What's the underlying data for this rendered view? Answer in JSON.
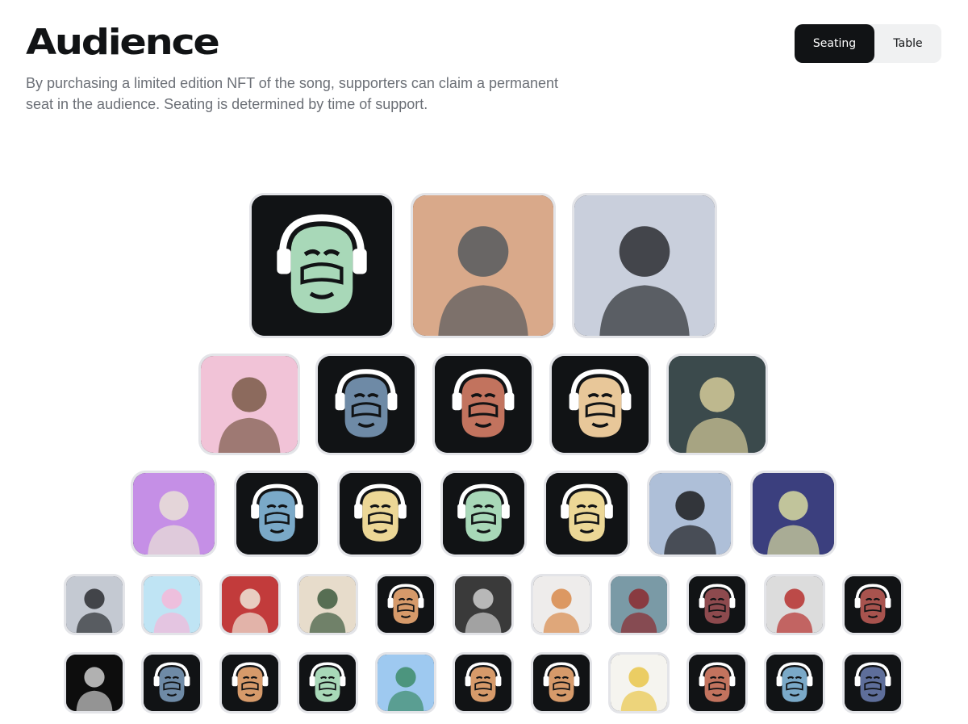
{
  "header": {
    "title": "Audience",
    "description": "By purchasing a limited edition NFT of the song, supporters can claim a permanent seat in the audience. Seating is determined by time of support."
  },
  "view_toggle": {
    "options": [
      "Seating",
      "Table"
    ],
    "selected": "Seating"
  },
  "colors": {
    "dark": "#111315",
    "seat_border": "#e3e4e8",
    "text_muted": "#6b6f76",
    "monkey_green": "#a8d8b8",
    "monkey_blue": "#6e8aa6",
    "monkey_red": "#c2735e",
    "monkey_tan": "#e8c799",
    "monkey_sky": "#7aa9c8",
    "monkey_orange": "#d69a6a",
    "monkey_maroon": "#8d4a4e",
    "monkey_yellow": "#ecd796"
  },
  "seating": {
    "rows": [
      [
        {
          "kind": "monkey",
          "icon": "monkey-headphones-icon",
          "color": "#a8d8b8",
          "label": "Supporter avatar"
        },
        {
          "kind": "photo",
          "icon": "bulldog-nft-avatar",
          "bg": "#d9a98a",
          "fg": "#555a5e"
        },
        {
          "kind": "photo",
          "icon": "person-portrait-avatar",
          "bg": "#c9cfdc",
          "fg": "#2b2d31"
        }
      ],
      [
        {
          "kind": "photo",
          "icon": "person-pink-avatar",
          "bg": "#f1c3d7",
          "fg": "#7a5a48"
        },
        {
          "kind": "monkey",
          "icon": "monkey-headphones-icon",
          "color": "#6e8aa6"
        },
        {
          "kind": "monkey",
          "icon": "monkey-headphones-icon",
          "color": "#c2735e"
        },
        {
          "kind": "monkey",
          "icon": "monkey-headphones-icon",
          "color": "#e8c799"
        },
        {
          "kind": "photo",
          "icon": "person-outdoor-avatar",
          "bg": "#3b4a4c",
          "fg": "#d6cb9a"
        }
      ],
      [
        {
          "kind": "photo",
          "icon": "robot-nft-avatar",
          "bg": "#c58fe6",
          "fg": "#e9e2d6"
        },
        {
          "kind": "monkey",
          "icon": "monkey-headphones-icon",
          "color": "#7aa9c8"
        },
        {
          "kind": "monkey",
          "icon": "monkey-headphones-icon",
          "color": "#ecd796"
        },
        {
          "kind": "monkey",
          "icon": "monkey-headphones-icon",
          "color": "#a8d8b8"
        },
        {
          "kind": "monkey",
          "icon": "monkey-headphones-icon",
          "color": "#ecd796"
        },
        {
          "kind": "photo",
          "icon": "dog-snow-avatar",
          "bg": "#aebfd8",
          "fg": "#1c1c1f"
        },
        {
          "kind": "photo",
          "icon": "ape-nft-avatar",
          "bg": "#3b3f7e",
          "fg": "#d9dca0"
        }
      ],
      [
        {
          "kind": "photo",
          "icon": "person-portrait-avatar",
          "bg": "#c4c9d2",
          "fg": "#2b2d31"
        },
        {
          "kind": "photo",
          "icon": "cartoon-nft-avatar",
          "bg": "#bfe4f4",
          "fg": "#f4b8d8"
        },
        {
          "kind": "photo",
          "icon": "hat-nft-avatar",
          "bg": "#c23b3b",
          "fg": "#efe7d9"
        },
        {
          "kind": "photo",
          "icon": "pixel-punk-avatar",
          "bg": "#e7dccb",
          "fg": "#3d5a3e"
        },
        {
          "kind": "monkey",
          "icon": "monkey-headphones-icon",
          "color": "#d69a6a"
        },
        {
          "kind": "photo",
          "icon": "person-bw-avatar",
          "bg": "#3a3a3a",
          "fg": "#cfcfcf"
        },
        {
          "kind": "photo",
          "icon": "cartoon-boy-avatar",
          "bg": "#eeeceb",
          "fg": "#d88a4a"
        },
        {
          "kind": "photo",
          "icon": "person-smiling-avatar",
          "bg": "#7a9aa6",
          "fg": "#8c2a2f"
        },
        {
          "kind": "monkey",
          "icon": "monkey-headphones-icon",
          "color": "#8d4a4e"
        },
        {
          "kind": "photo",
          "icon": "cap-nft-avatar",
          "bg": "#dcdcdc",
          "fg": "#b6302e"
        },
        {
          "kind": "monkey",
          "icon": "monkey-headphones-icon",
          "color": "#a8534e"
        }
      ],
      [
        {
          "kind": "photo",
          "icon": "wizard-pixel-avatar",
          "bg": "#0d0d0d",
          "fg": "#cfcfcf"
        },
        {
          "kind": "monkey",
          "icon": "monkey-headphones-icon",
          "color": "#6e8aa6"
        },
        {
          "kind": "monkey",
          "icon": "monkey-headphones-icon",
          "color": "#d69a6a"
        },
        {
          "kind": "monkey",
          "icon": "monkey-headphones-icon",
          "color": "#a8d8b8"
        },
        {
          "kind": "photo",
          "icon": "green-hair-avatar",
          "bg": "#9ec9f0",
          "fg": "#3d8c6a"
        },
        {
          "kind": "monkey",
          "icon": "monkey-headphones-icon",
          "color": "#d69a6a"
        },
        {
          "kind": "monkey",
          "icon": "monkey-headphones-icon",
          "color": "#d69a6a"
        },
        {
          "kind": "photo",
          "icon": "llama-pixel-avatar",
          "bg": "#f5f4ef",
          "fg": "#e9c64a"
        },
        {
          "kind": "monkey",
          "icon": "monkey-headphones-icon",
          "color": "#c2735e"
        },
        {
          "kind": "monkey",
          "icon": "monkey-headphones-icon",
          "color": "#7aa9c8"
        },
        {
          "kind": "monkey",
          "icon": "monkey-headphones-icon",
          "color": "#5e6e9a"
        }
      ]
    ]
  }
}
